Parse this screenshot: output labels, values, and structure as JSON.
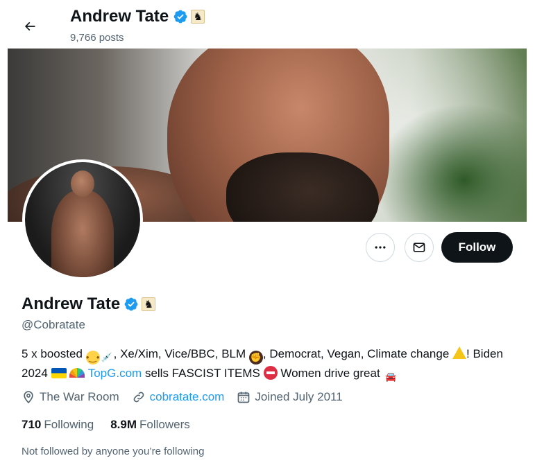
{
  "header": {
    "name": "Andrew Tate",
    "posts": "9,766 posts"
  },
  "profile": {
    "name": "Andrew Tate",
    "handle": "@Cobratate",
    "bio": {
      "part1": "5 x boosted",
      "part2": ", Xe/Xim, Vice/BBC, BLM",
      "part3": ", Democrat, Vegan, Climate change",
      "part4": "! Biden 2024",
      "link": "TopG.com",
      "part5": "sells FASCIST ITEMS",
      "part6": "Women drive great"
    },
    "location": "The War Room",
    "website": "cobratate.com",
    "joined": "Joined July 2011",
    "following_count": "710",
    "following_label": "Following",
    "followers_count": "8.9M",
    "followers_label": "Followers",
    "not_followed": "Not followed by anyone you’re following"
  },
  "actions": {
    "follow_label": "Follow"
  },
  "colors": {
    "accent": "#1d9bf0",
    "text": "#0f1419",
    "muted": "#536471",
    "follow_bg": "#0f1419"
  }
}
